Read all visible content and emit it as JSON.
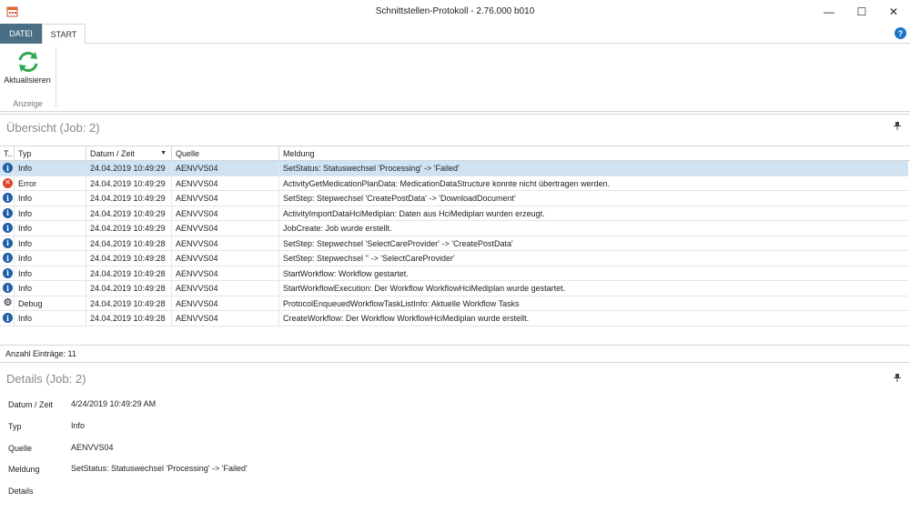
{
  "window": {
    "title": "Schnittstellen-Protokoll - 2.76.000 b010",
    "minimize": "—",
    "maximize": "☐",
    "close": "✕"
  },
  "ribbon": {
    "tabs": [
      {
        "label": "DATEI"
      },
      {
        "label": "START"
      }
    ],
    "help": "?",
    "refresh_label": "Aktualisieren",
    "group_label": "Anzeige"
  },
  "overview": {
    "title": "Übersicht (Job: 2)",
    "pin": "📌",
    "columns": {
      "typ_icon": "T..",
      "typ": "Typ",
      "datum": "Datum / Zeit",
      "quelle": "Quelle",
      "meldung": "Meldung"
    },
    "rows": [
      {
        "icon": "info-icon",
        "typ": "Info",
        "datum": "24.04.2019 10:49:29",
        "quelle": "AENVVS04",
        "meldung": "SetStatus: Statuswechsel 'Processing' -> 'Failed'"
      },
      {
        "icon": "error-icon",
        "typ": "Error",
        "datum": "24.04.2019 10:49:29",
        "quelle": "AENVVS04",
        "meldung": "ActivityGetMedicationPlanData: MedicationDataStructure konnte nicht übertragen werden."
      },
      {
        "icon": "info-icon",
        "typ": "Info",
        "datum": "24.04.2019 10:49:29",
        "quelle": "AENVVS04",
        "meldung": "SetStep: Stepwechsel 'CreatePostData' -> 'DownloadDocument'"
      },
      {
        "icon": "info-icon",
        "typ": "Info",
        "datum": "24.04.2019 10:49:29",
        "quelle": "AENVVS04",
        "meldung": "ActivityImportDataHciMediplan: Daten aus HciMediplan wurden erzeugt."
      },
      {
        "icon": "info-icon",
        "typ": "Info",
        "datum": "24.04.2019 10:49:29",
        "quelle": "AENVVS04",
        "meldung": "JobCreate: Job wurde erstellt."
      },
      {
        "icon": "info-icon",
        "typ": "Info",
        "datum": "24.04.2019 10:49:28",
        "quelle": "AENVVS04",
        "meldung": "SetStep: Stepwechsel 'SelectCareProvider' -> 'CreatePostData'"
      },
      {
        "icon": "info-icon",
        "typ": "Info",
        "datum": "24.04.2019 10:49:28",
        "quelle": "AENVVS04",
        "meldung": "SetStep: Stepwechsel '' -> 'SelectCareProvider'"
      },
      {
        "icon": "info-icon",
        "typ": "Info",
        "datum": "24.04.2019 10:49:28",
        "quelle": "AENVVS04",
        "meldung": "StartWorkflow: Workflow gestartet."
      },
      {
        "icon": "info-icon",
        "typ": "Info",
        "datum": "24.04.2019 10:49:28",
        "quelle": "AENVVS04",
        "meldung": "StartWorkflowExecution: Der Workflow WorkflowHciMediplan wurde gestartet."
      },
      {
        "icon": "debug-icon",
        "typ": "Debug",
        "datum": "24.04.2019 10:49:28",
        "quelle": "AENVVS04",
        "meldung": "ProtocolEnqueuedWorkflowTaskListInfo: Aktuelle Workflow Tasks"
      },
      {
        "icon": "info-icon",
        "typ": "Info",
        "datum": "24.04.2019 10:49:28",
        "quelle": "AENVVS04",
        "meldung": "CreateWorkflow: Der Workflow WorkflowHciMediplan wurde erstellt."
      }
    ],
    "count_label": "Anzahl Einträge: 11"
  },
  "details": {
    "title": "Details (Job: 2)",
    "pin": "📌",
    "fields": [
      {
        "label": "Datum / Zeit",
        "value": "4/24/2019 10:49:29 AM"
      },
      {
        "label": "Typ",
        "value": "Info"
      },
      {
        "label": "Quelle",
        "value": "AENVVS04"
      },
      {
        "label": "Meldung",
        "value": "SetStatus: Statuswechsel 'Processing' -> 'Failed'"
      },
      {
        "label": "Details",
        "value": ""
      }
    ]
  },
  "colors": {
    "accent": "#4a6f85",
    "selection": "#cfe3f3",
    "info": "#1f5fa8",
    "error": "#d9482b",
    "refresh": "#2eaa4e"
  }
}
